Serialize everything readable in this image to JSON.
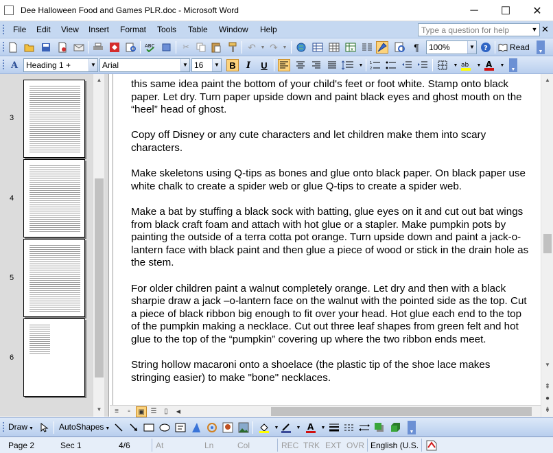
{
  "window": {
    "title": "Dee Halloween Food and Games PLR.doc - Microsoft Word",
    "minimize_glyph": "─",
    "maximize_glyph": "☐",
    "close_glyph": "✕"
  },
  "menubar": {
    "items": [
      "File",
      "Edit",
      "View",
      "Insert",
      "Format",
      "Tools",
      "Table",
      "Window",
      "Help"
    ],
    "help_placeholder": "Type a question for help",
    "close_glyph": "✕"
  },
  "standard_toolbar": {
    "zoom": "100%",
    "read_label": "Read"
  },
  "formatting_toolbar": {
    "style": "Heading 1 +",
    "font": "Arial",
    "size": "16",
    "bold": "B",
    "italic": "I",
    "underline": "U"
  },
  "thumbnails": {
    "pages": [
      "3",
      "4",
      "5",
      "6"
    ]
  },
  "document": {
    "paragraphs": [
      "this same idea paint the bottom of your child's feet or foot white. Stamp onto black paper. Let dry. Turn paper upside down and paint black eyes and ghost mouth on the “heel” head of ghost.",
      "Copy off Disney or any cute characters and let children make them into scary characters.",
      "Make skeletons using Q-tips as bones and glue onto black paper. On black paper use white chalk to create a spider web or glue Q-tips to create a spider web.",
      "Make a bat by stuffing a black sock with batting, glue eyes on it and cut out bat wings from black craft foam and attach with hot glue or a stapler. Make pumpkin pots by painting the outside of a terra cotta pot orange. Turn upside down and paint a jack-o-lantern face with black paint and then glue a piece of wood or stick in the drain hole as the stem.",
      "For older children paint a walnut completely orange. Let dry and then with a black sharpie draw a jack –o-lantern face on the walnut with the pointed side as the top. Cut a piece of black ribbon big enough to fit over your head. Hot glue each end to the top of the pumpkin making a necklace. Cut out three leaf shapes from green felt and hot glue to the top of the “pumpkin” covering up where the two ribbon ends meet.",
      "String hollow macaroni onto a shoelace (the plastic tip of the shoe lace makes stringing easier) to make \"bone\" necklaces."
    ]
  },
  "drawing_toolbar": {
    "draw_label": "Draw",
    "autoshapes_label": "AutoShapes"
  },
  "statusbar": {
    "page": "Page 2",
    "section": "Sec 1",
    "page_of": "4/6",
    "at": "At",
    "ln": "Ln",
    "col": "Col",
    "rec": "REC",
    "trk": "TRK",
    "ext": "EXT",
    "ovr": "OVR",
    "language": "English (U.S."
  },
  "colors": {
    "menubar": "#c5d8f1",
    "toolbar_top": "#dce8f8",
    "toolbar_bottom": "#b9cfee",
    "pressed": "#fcd37c"
  }
}
